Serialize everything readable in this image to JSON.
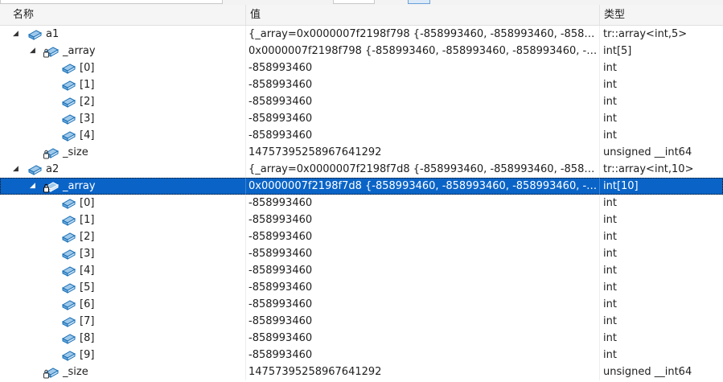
{
  "header": {
    "name": "名称",
    "value": "值",
    "type": "类型"
  },
  "rows": [
    {
      "depth": 0,
      "arrow": "expanded",
      "icon": "field",
      "locked": false,
      "name": "a1",
      "value": "{_array=0x0000007f2198f798 {-858993460, -858993460, -858993...",
      "type": "tr::array<int,5>"
    },
    {
      "depth": 1,
      "arrow": "expanded",
      "icon": "field",
      "locked": true,
      "name": "_array",
      "value": "0x0000007f2198f798 {-858993460, -858993460, -858993460, -85...",
      "type": "int[5]"
    },
    {
      "depth": 2,
      "arrow": "none",
      "icon": "field",
      "locked": false,
      "name": "[0]",
      "value": "-858993460",
      "type": "int"
    },
    {
      "depth": 2,
      "arrow": "none",
      "icon": "field",
      "locked": false,
      "name": "[1]",
      "value": "-858993460",
      "type": "int"
    },
    {
      "depth": 2,
      "arrow": "none",
      "icon": "field",
      "locked": false,
      "name": "[2]",
      "value": "-858993460",
      "type": "int"
    },
    {
      "depth": 2,
      "arrow": "none",
      "icon": "field",
      "locked": false,
      "name": "[3]",
      "value": "-858993460",
      "type": "int"
    },
    {
      "depth": 2,
      "arrow": "none",
      "icon": "field",
      "locked": false,
      "name": "[4]",
      "value": "-858993460",
      "type": "int"
    },
    {
      "depth": 1,
      "arrow": "none",
      "icon": "field",
      "locked": true,
      "name": "_size",
      "value": "14757395258967641292",
      "type": "unsigned __int64"
    },
    {
      "depth": 0,
      "arrow": "expanded",
      "icon": "field",
      "locked": false,
      "name": "a2",
      "value": "{_array=0x0000007f2198f7d8 {-858993460, -858993460, -858993...",
      "type": "tr::array<int,10>"
    },
    {
      "depth": 1,
      "arrow": "expanded",
      "icon": "field",
      "locked": true,
      "selected": true,
      "name": "_array",
      "value": "0x0000007f2198f7d8 {-858993460, -858993460, -858993460, -85...",
      "type": "int[10]"
    },
    {
      "depth": 2,
      "arrow": "none",
      "icon": "field",
      "locked": false,
      "name": "[0]",
      "value": "-858993460",
      "type": "int"
    },
    {
      "depth": 2,
      "arrow": "none",
      "icon": "field",
      "locked": false,
      "name": "[1]",
      "value": "-858993460",
      "type": "int"
    },
    {
      "depth": 2,
      "arrow": "none",
      "icon": "field",
      "locked": false,
      "name": "[2]",
      "value": "-858993460",
      "type": "int"
    },
    {
      "depth": 2,
      "arrow": "none",
      "icon": "field",
      "locked": false,
      "name": "[3]",
      "value": "-858993460",
      "type": "int"
    },
    {
      "depth": 2,
      "arrow": "none",
      "icon": "field",
      "locked": false,
      "name": "[4]",
      "value": "-858993460",
      "type": "int"
    },
    {
      "depth": 2,
      "arrow": "none",
      "icon": "field",
      "locked": false,
      "name": "[5]",
      "value": "-858993460",
      "type": "int"
    },
    {
      "depth": 2,
      "arrow": "none",
      "icon": "field",
      "locked": false,
      "name": "[6]",
      "value": "-858993460",
      "type": "int"
    },
    {
      "depth": 2,
      "arrow": "none",
      "icon": "field",
      "locked": false,
      "name": "[7]",
      "value": "-858993460",
      "type": "int"
    },
    {
      "depth": 2,
      "arrow": "none",
      "icon": "field",
      "locked": false,
      "name": "[8]",
      "value": "-858993460",
      "type": "int"
    },
    {
      "depth": 2,
      "arrow": "none",
      "icon": "field",
      "locked": false,
      "name": "[9]",
      "value": "-858993460",
      "type": "int"
    },
    {
      "depth": 1,
      "arrow": "none",
      "icon": "field",
      "locked": true,
      "name": "_size",
      "value": "14757395258967641292",
      "type": "unsigned __int64"
    }
  ],
  "colors": {
    "selection": "#0a64c7",
    "icon_fill": "#9fc9ea",
    "icon_stroke": "#1a6fb5",
    "lock": "#333333"
  }
}
